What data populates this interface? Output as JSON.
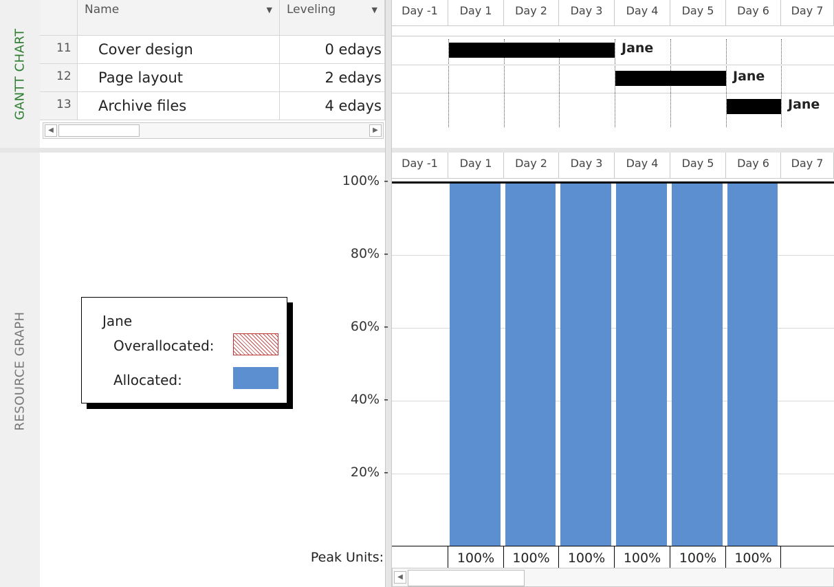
{
  "side_labels": {
    "gantt": "GANTT CHART",
    "resource": "RESOURCE GRAPH"
  },
  "table": {
    "columns": {
      "name": "Name",
      "leveling": "Leveling"
    },
    "rows": [
      {
        "id": "11",
        "name": "Cover design",
        "leveling": "0 edays"
      },
      {
        "id": "12",
        "name": "Page layout",
        "leveling": "2 edays"
      },
      {
        "id": "13",
        "name": "Archive files",
        "leveling": "4 edays"
      }
    ]
  },
  "timescale": [
    "Day -1",
    "Day 1",
    "Day 2",
    "Day 3",
    "Day 4",
    "Day 5",
    "Day 6",
    "Day 7"
  ],
  "gantt_bars": [
    {
      "task": "Cover design",
      "start_day": "Day 1",
      "end_day": "Day 3",
      "resource": "Jane"
    },
    {
      "task": "Page layout",
      "start_day": "Day 4",
      "end_day": "Day 5",
      "resource": "Jane"
    },
    {
      "task": "Archive files",
      "start_day": "Day 6",
      "end_day": "Day 6",
      "resource": "Jane"
    }
  ],
  "legend": {
    "resource": "Jane",
    "overallocated_label": "Overallocated:",
    "allocated_label": "Allocated:",
    "colors": {
      "allocated": "#5b8fcf",
      "overallocated": "#c0504d"
    }
  },
  "peak_units_label": "Peak Units:",
  "chart_data": {
    "type": "bar",
    "categories": [
      "Day -1",
      "Day 1",
      "Day 2",
      "Day 3",
      "Day 4",
      "Day 5",
      "Day 6",
      "Day 7"
    ],
    "series": [
      {
        "name": "Allocated",
        "values": [
          0,
          100,
          100,
          100,
          100,
          100,
          100,
          0
        ]
      }
    ],
    "peak_units": [
      "",
      "100%",
      "100%",
      "100%",
      "100%",
      "100%",
      "100%",
      ""
    ],
    "y_ticks": [
      "100%",
      "80%",
      "60%",
      "40%",
      "20%"
    ],
    "ylim": [
      0,
      100
    ],
    "max_units_line": 100,
    "grid": true
  }
}
